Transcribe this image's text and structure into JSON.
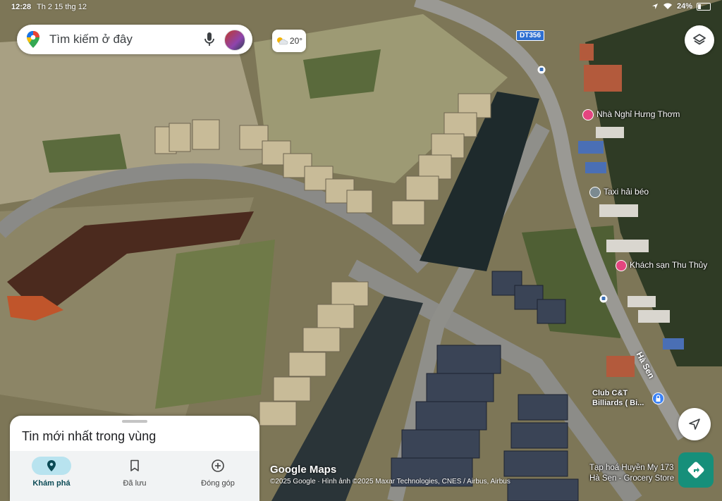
{
  "status_bar": {
    "time": "12:28",
    "date": "Th 2 15 thg 12",
    "battery": "24%",
    "battery_level": 0.24
  },
  "search": {
    "placeholder": "Tìm kiếm ở đây",
    "icon_left": "maps-pin-icon",
    "icon_mic": "mic-icon",
    "icon_avatar": "avatar"
  },
  "weather": {
    "temp": "20°",
    "icon": "partly-cloudy-icon"
  },
  "route_badge": "DT356",
  "pois": [
    {
      "label": "Nhà Nghỉ Hưng Thơm",
      "icon": "bed-icon",
      "color": "#e3457f"
    },
    {
      "label": "Taxi hải béo",
      "icon": "place-icon",
      "color": "#7b8a90"
    },
    {
      "label": "Khách sạn Thu Thủy",
      "icon": "bed-icon",
      "color": "#e3457f"
    },
    {
      "label": "Club C&T Billiards ( Bi...",
      "icon": "lock-icon",
      "color": "#3b82f6"
    },
    {
      "label": "Tạp hoá Huyền My 173 Hà Sen - Grocery Store",
      "icon": "store-icon",
      "color": "#3b82f6"
    }
  ],
  "street_label": "Hà Sen",
  "map_logo": "Google Maps",
  "copyright": "©2025 Google · Hình ảnh ©2025 Maxar Technologies, CNES / Airbus, Airbus",
  "sheet": {
    "title": "Tin mới nhất trong vùng",
    "tabs": [
      {
        "label": "Khám phá",
        "icon": "explore-pin-icon",
        "active": true
      },
      {
        "label": "Đã lưu",
        "icon": "bookmark-icon",
        "active": false
      },
      {
        "label": "Đóng góp",
        "icon": "add-circle-icon",
        "active": false
      }
    ]
  },
  "controls": {
    "layers": "layers-icon",
    "navigate": "navigation-arrow-icon",
    "directions": "directions-icon"
  }
}
